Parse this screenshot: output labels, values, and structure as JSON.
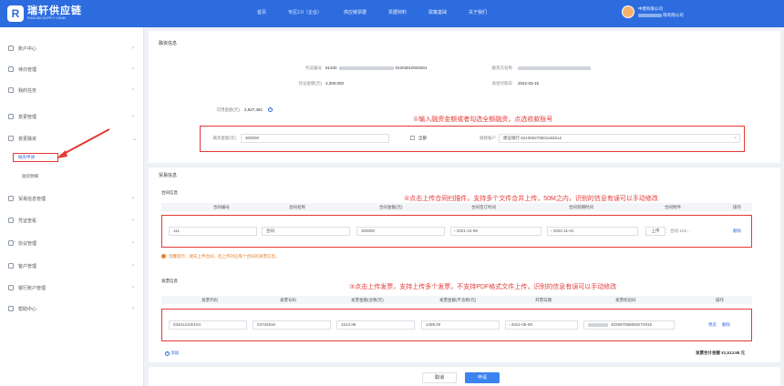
{
  "brand": {
    "logo_mark": "R",
    "name": "瑞轩供应链",
    "sub": "RUIXUAN SUPPLY CHAIN"
  },
  "nav": [
    "首页",
    "专区2.0（企业）",
    "供应链票据",
    "票据材料",
    "政策基础",
    "关于我们"
  ],
  "user": {
    "line1": "中建有限公司",
    "line2_suffix": "限有限公司"
  },
  "sidebar": {
    "items": [
      "账户中心",
      "待办管理",
      "我的任务",
      "变更管理",
      "变更融资",
      "贸易信息管理",
      "凭证查看",
      "协议管理",
      "客户管理",
      "银行账户管理",
      "帮助中心"
    ],
    "subs": [
      "融资申请",
      "融资明细"
    ]
  },
  "financing": {
    "section_title": "融资信息",
    "voucher_no_label": "凭证编号",
    "voucher_no_prefix": "91340",
    "voucher_no_suffix": "02203010040001",
    "issuer_label": "融资方名称",
    "voucher_amount_label": "凭证金额(元)",
    "voucher_amount": "3,300,000",
    "due_date_label": "承诺付款日",
    "due_date": "2022-03-15",
    "available_label": "可用金额(元)",
    "available_amount": "2,927,481",
    "finance_amount_label": "融资金额(元)",
    "finance_amount": "300000",
    "all_label": "全部",
    "account_label": "收款账户",
    "account_value": "建设银行  621055278831182612"
  },
  "trade": {
    "section_title": "贸易信息",
    "contract_title": "合同信息",
    "contract_headers": [
      "合同编号",
      "合同名称",
      "合同金额(元)",
      "合同签订时间",
      "合同到期时间",
      "合同附件",
      "操作"
    ],
    "contract_row": [
      "111",
      "合同",
      "300000",
      "2021-10-08",
      "2022-11-01",
      "上传",
      "合同-102...",
      "删除"
    ],
    "warning": "温馨提示：请先上传合同，后上传对应每个合同的发票信息。",
    "invoice_title": "发票信息",
    "invoice_headers": [
      "发票代码",
      "发票号码",
      "发票金额(含税/元)",
      "发票金额(不含税/元)",
      "开票日期",
      "发票校验码",
      "操作"
    ],
    "invoice_row": [
      "034012100104",
      "04734916",
      "1513.98",
      "1499.00",
      "2021-06-09",
      "402997058809272916",
      "预览",
      "删除"
    ],
    "add_label": "添加",
    "total_label": "发票合计金额",
    "total_value": "¥1,513.98 元"
  },
  "annotations": {
    "a1": "①输入融资金额或者勾选全额融资，点选收款账号",
    "a2": "②点击上传合同扫描件，支持多个文件合并上传，50M之内，识别的信息有误可以手动修改",
    "a3": "③点击上传发票，支持上传多个发票，不支持PDF格式文件上传，识别的信息有误可以手动修改"
  },
  "buttons": {
    "cancel": "取消",
    "submit": "申请"
  },
  "colors": {
    "primary": "#2d6cdf",
    "annotation": "#e53935",
    "warning": "#e6812b"
  }
}
